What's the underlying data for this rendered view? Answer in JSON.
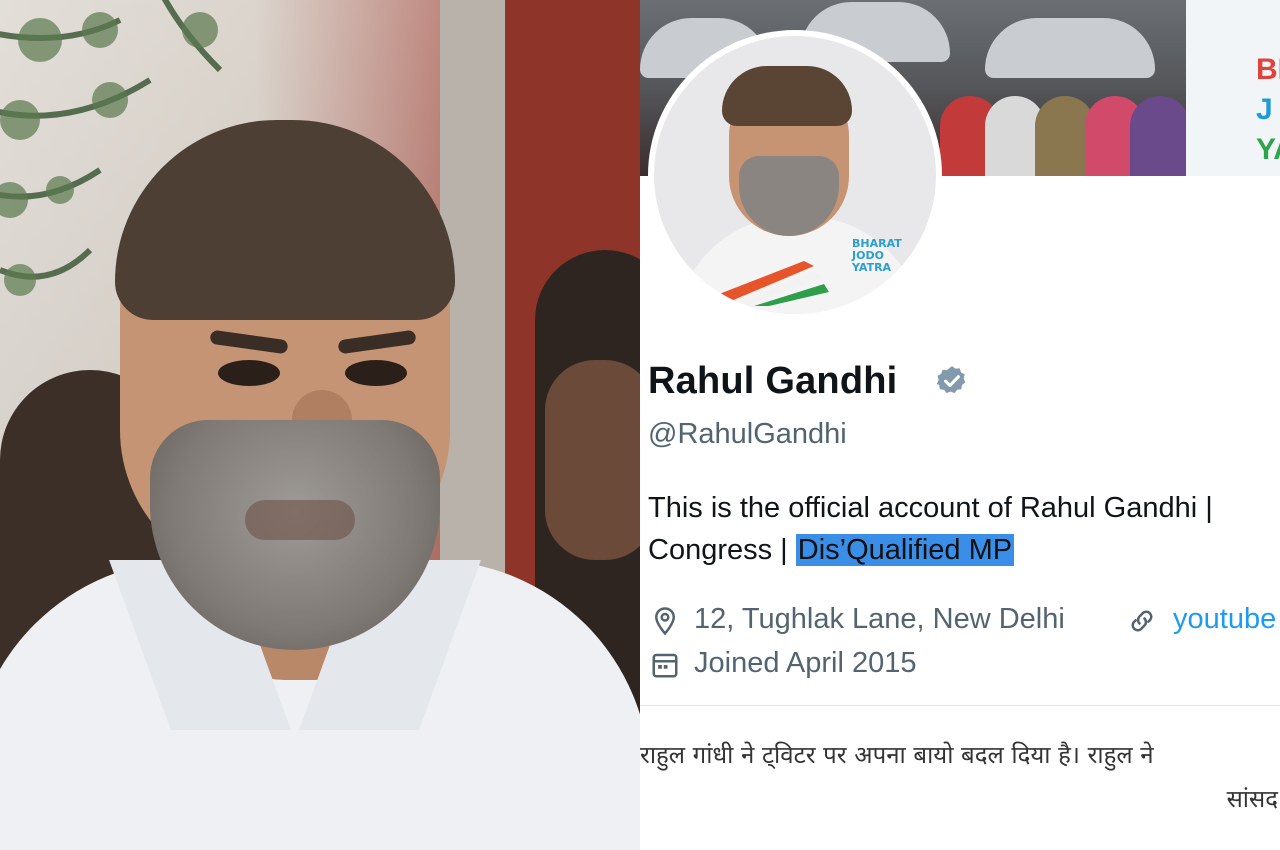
{
  "profile": {
    "name": "Rahul Gandhi",
    "handle": "@RahulGandhi",
    "bio_line1": "This is the official account of Rahul Gandhi |",
    "bio_line2_prefix": "Congress | ",
    "bio_highlight": "Dis’Qualified MP",
    "location": "12, Tughlak Lane, New Delhi",
    "website": "youtube",
    "joined": "Joined April 2015",
    "avatar_badge_lines": [
      "BHARAT",
      "JODO",
      "YATRA"
    ],
    "banner_text": [
      "BH",
      "J",
      "YA"
    ]
  },
  "caption": {
    "line1": "राहुल गांधी ने ट्विटर पर अपना बायो बदल दिया है। राहुल ने",
    "line2": "सांसद"
  },
  "colors": {
    "verified": "#829aab",
    "link": "#1d9bf0",
    "highlight": "#3b8ee8",
    "text_primary": "#0f1419",
    "text_secondary": "#536471"
  },
  "icons": [
    "verified-icon",
    "location-icon",
    "link-icon",
    "calendar-icon"
  ]
}
